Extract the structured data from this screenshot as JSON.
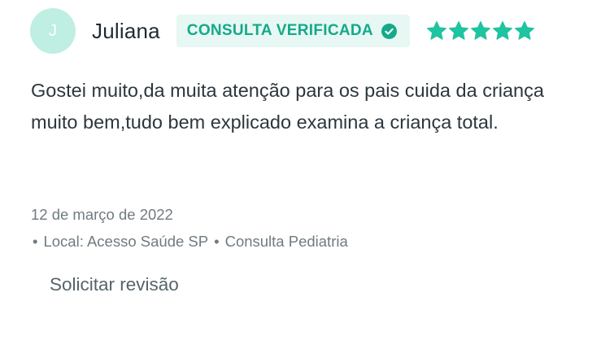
{
  "review": {
    "avatar_initial": "J",
    "author": "Juliana",
    "verified_label": "CONSULTA VERIFICADA",
    "rating": 5,
    "rating_max": 5,
    "text": "Gostei muito,da muita atenção para os pais cuida da criança muito bem,tudo bem explicado examina a criança total.",
    "date": "12 de março de 2022",
    "location": "Local: Acesso Saúde SP",
    "service": "Consulta Pediatria",
    "bullet": "•",
    "request_review_label": "Solicitar revisão"
  },
  "colors": {
    "accent": "#14a98a",
    "badge_background": "#e7f7f3",
    "avatar_background": "#bfeee2",
    "star": "#1fc4a0"
  },
  "icons": {
    "verified": "check-circle-icon",
    "rating": "star-icon"
  }
}
